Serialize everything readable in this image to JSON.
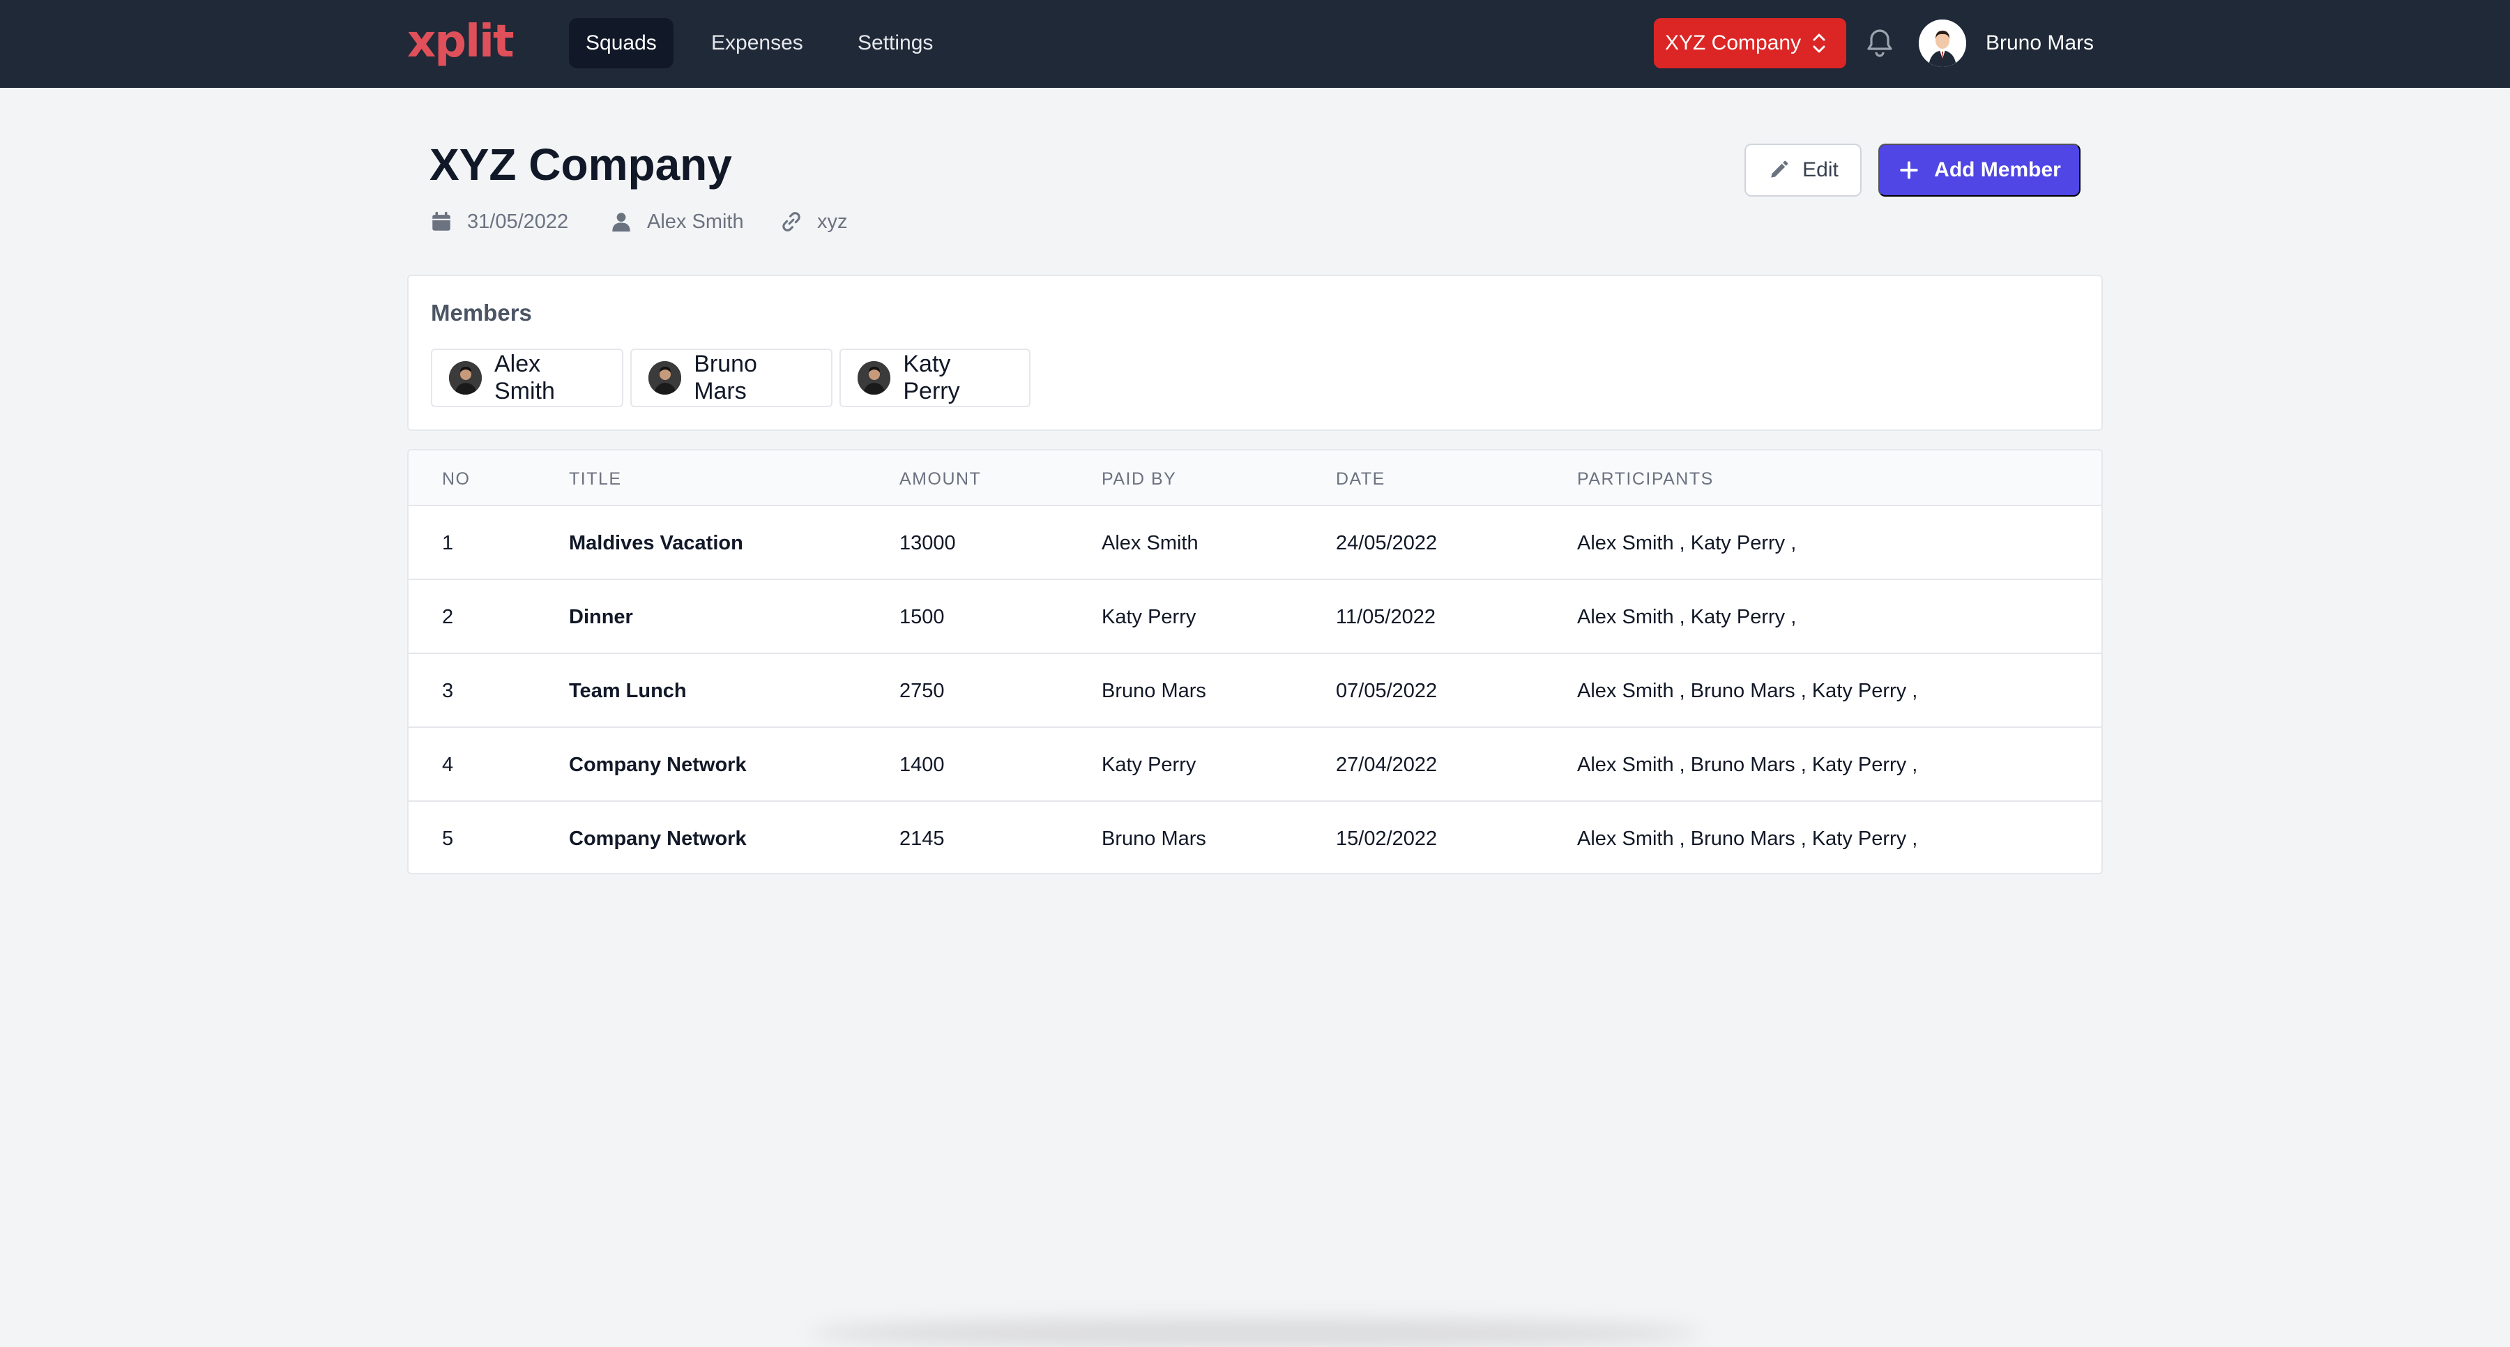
{
  "app": {
    "logo": "xplit",
    "brand_color": "#e0505a"
  },
  "nav": {
    "tabs": [
      {
        "label": "Squads",
        "active": true
      },
      {
        "label": "Expenses",
        "active": false
      },
      {
        "label": "Settings",
        "active": false
      }
    ],
    "company_select": "XYZ Company",
    "user_name": "Bruno Mars"
  },
  "squad": {
    "title": "XYZ Company",
    "date": "31/05/2022",
    "owner": "Alex Smith",
    "link": "xyz",
    "edit_label": "Edit",
    "add_member_label": "Add Member"
  },
  "members": {
    "heading": "Members",
    "list": [
      "Alex Smith",
      "Bruno Mars",
      "Katy Perry"
    ]
  },
  "expenses": {
    "columns": [
      "NO",
      "TITLE",
      "AMOUNT",
      "PAID BY",
      "DATE",
      "PARTICIPANTS"
    ],
    "rows": [
      {
        "no": "1",
        "title": "Maldives Vacation",
        "amount": "13000",
        "paid_by": "Alex Smith",
        "date": "24/05/2022",
        "participants": "Alex Smith , Katy Perry ,"
      },
      {
        "no": "2",
        "title": "Dinner",
        "amount": "1500",
        "paid_by": "Katy Perry",
        "date": "11/05/2022",
        "participants": "Alex Smith , Katy Perry ,"
      },
      {
        "no": "3",
        "title": "Team Lunch",
        "amount": "2750",
        "paid_by": "Bruno Mars",
        "date": "07/05/2022",
        "participants": "Alex Smith , Bruno Mars , Katy Perry ,"
      },
      {
        "no": "4",
        "title": "Company Network",
        "amount": "1400",
        "paid_by": "Katy Perry",
        "date": "27/04/2022",
        "participants": "Alex Smith , Bruno Mars , Katy Perry ,"
      },
      {
        "no": "5",
        "title": "Company Network",
        "amount": "2145",
        "paid_by": "Bruno Mars",
        "date": "15/02/2022",
        "participants": "Alex Smith , Bruno Mars , Katy Perry ,"
      }
    ]
  },
  "icons": {
    "chevron": "chevron-up-down-icon",
    "bell": "bell-icon",
    "calendar": "calendar-icon",
    "owner": "user-icon",
    "link": "link-icon",
    "edit": "pencil-icon",
    "add": "plus-icon"
  },
  "colors": {
    "nav_bg": "#1f2937",
    "company_select_bg": "#dc2626",
    "primary": "#4f46e5",
    "page_bg": "#f3f4f6"
  }
}
